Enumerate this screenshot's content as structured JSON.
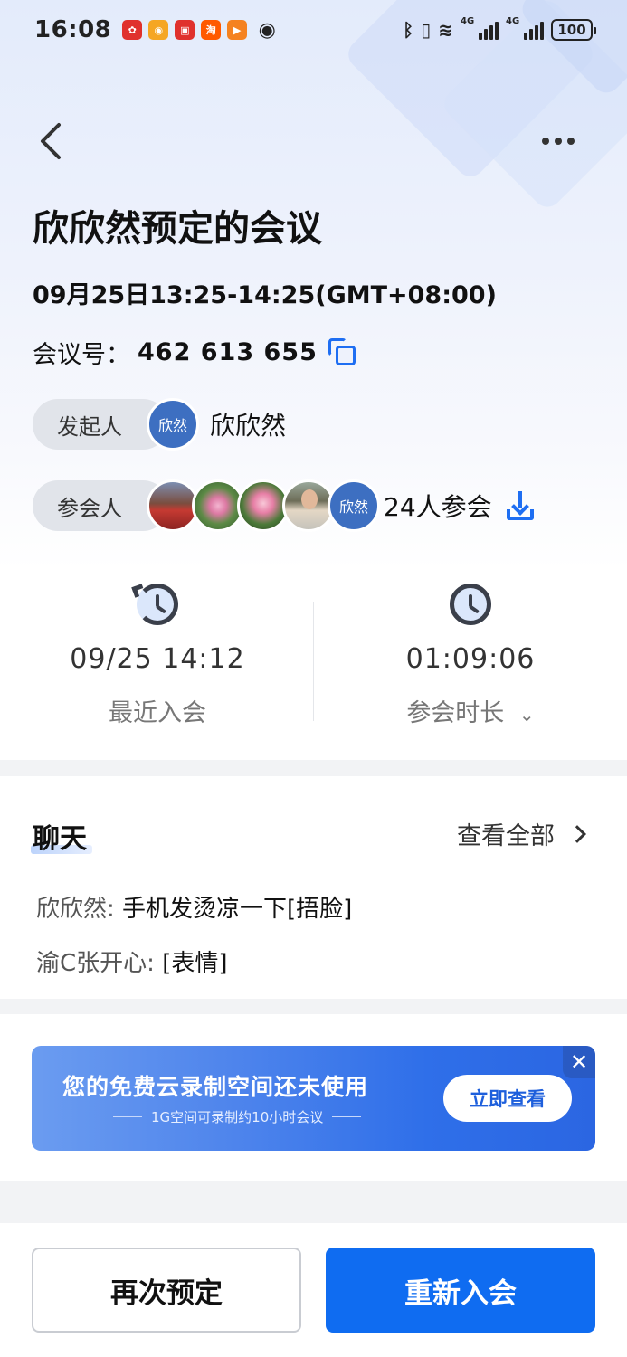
{
  "status_bar": {
    "time": "16:08",
    "app_icons": [
      {
        "name": "huawei-icon",
        "glyph": "✿",
        "color": "#e0312d"
      },
      {
        "name": "weibo-icon",
        "glyph": "◉",
        "color": "#f5a623"
      },
      {
        "name": "red-app-icon",
        "glyph": "▣",
        "color": "#e0312d"
      },
      {
        "name": "taobao-icon",
        "glyph": "淘",
        "color": "#ff5a00"
      },
      {
        "name": "video-app-icon",
        "glyph": "▶",
        "color": "#f58220"
      }
    ],
    "network_label": "4G",
    "battery": "100"
  },
  "meeting": {
    "title": "欣欣然预定的会议",
    "datetime": "09月25日13:25-14:25(GMT+08:00)",
    "id_label": "会议号：",
    "id_value": "462 613 655",
    "initiator_label": "发起人",
    "initiator_avatar": "欣然",
    "initiator_name": "欣欣然",
    "participants_label": "参会人",
    "participant_avatar_text": "欣然",
    "participants_count": "24人参会"
  },
  "stats": {
    "last_join_value": "09/25 14:12",
    "last_join_label": "最近入会",
    "duration_value": "01:09:06",
    "duration_label": "参会时长"
  },
  "chat": {
    "title": "聊天",
    "view_all": "查看全部",
    "messages": [
      {
        "sender": "欣欣然:",
        "text": "手机发烫凉一下[捂脸]"
      },
      {
        "sender": "渝C张开心:",
        "text": "[表情]"
      }
    ]
  },
  "banner": {
    "title": "您的免费云录制空间还未使用",
    "subtitle": "1G空间可录制约10小时会议",
    "button": "立即查看",
    "close": "✕"
  },
  "actions": {
    "rebook": "再次预定",
    "rejoin": "重新入会"
  },
  "colors": {
    "accent": "#0f6cf1",
    "avatar": "#3d6fc1"
  }
}
